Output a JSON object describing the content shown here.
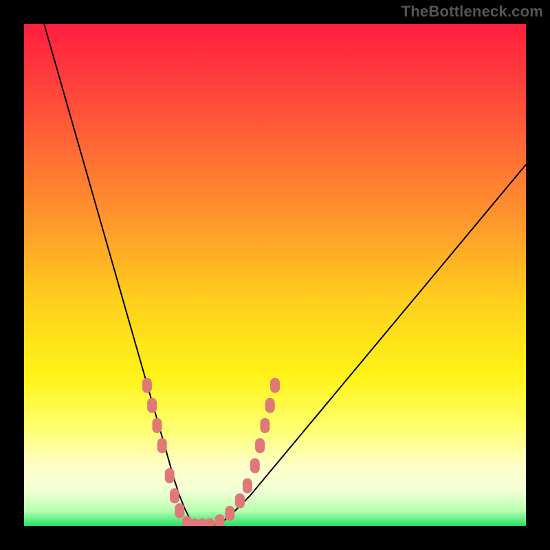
{
  "watermark": "TheBottleneck.com",
  "chart_data": {
    "type": "line",
    "title": "",
    "xlabel": "",
    "ylabel": "",
    "xlim": [
      0,
      100
    ],
    "ylim": [
      0,
      100
    ],
    "background_gradient": {
      "stops": [
        {
          "offset": 0.0,
          "color": "#ff1f3f"
        },
        {
          "offset": 0.1,
          "color": "#ff3a3d"
        },
        {
          "offset": 0.25,
          "color": "#ff6a34"
        },
        {
          "offset": 0.4,
          "color": "#ff9a2c"
        },
        {
          "offset": 0.55,
          "color": "#ffcf1e"
        },
        {
          "offset": 0.7,
          "color": "#fff317"
        },
        {
          "offset": 0.8,
          "color": "#ffff6a"
        },
        {
          "offset": 0.88,
          "color": "#ffffc8"
        },
        {
          "offset": 0.93,
          "color": "#f2ffd6"
        },
        {
          "offset": 0.97,
          "color": "#b8ffb0"
        },
        {
          "offset": 1.0,
          "color": "#22e06a"
        }
      ]
    },
    "series": [
      {
        "name": "bottleneck-curve",
        "color": "#000000",
        "x": [
          4,
          6,
          8,
          10,
          12,
          14,
          16,
          18,
          20,
          22,
          24,
          26,
          28,
          30,
          31,
          32,
          33,
          34,
          35,
          36,
          38,
          40,
          42,
          45,
          50,
          55,
          60,
          65,
          70,
          75,
          80,
          85,
          90,
          95,
          100
        ],
        "y": [
          100,
          93,
          86,
          79,
          72,
          65,
          58,
          51,
          44,
          37,
          30,
          23,
          16,
          9,
          6,
          3.5,
          1.5,
          0.5,
          0,
          0,
          0.2,
          1.2,
          3,
          6,
          12,
          18,
          24,
          30,
          36,
          42,
          48,
          54,
          60,
          66,
          72
        ]
      }
    ],
    "markers": {
      "name": "highlighted-range",
      "color": "#e07878",
      "points": [
        {
          "x": 24.5,
          "y": 28
        },
        {
          "x": 25.5,
          "y": 24
        },
        {
          "x": 26.5,
          "y": 20
        },
        {
          "x": 27.5,
          "y": 16
        },
        {
          "x": 29.0,
          "y": 10
        },
        {
          "x": 30.0,
          "y": 6
        },
        {
          "x": 31.0,
          "y": 3
        },
        {
          "x": 32.5,
          "y": 0.5
        },
        {
          "x": 34.0,
          "y": 0
        },
        {
          "x": 35.5,
          "y": 0
        },
        {
          "x": 37.0,
          "y": 0
        },
        {
          "x": 39.0,
          "y": 0.8
        },
        {
          "x": 41.0,
          "y": 2.5
        },
        {
          "x": 43.0,
          "y": 5
        },
        {
          "x": 44.5,
          "y": 8
        },
        {
          "x": 46.0,
          "y": 12
        },
        {
          "x": 47.0,
          "y": 16
        },
        {
          "x": 48.0,
          "y": 20
        },
        {
          "x": 49.0,
          "y": 24
        },
        {
          "x": 50.0,
          "y": 28
        }
      ]
    }
  }
}
